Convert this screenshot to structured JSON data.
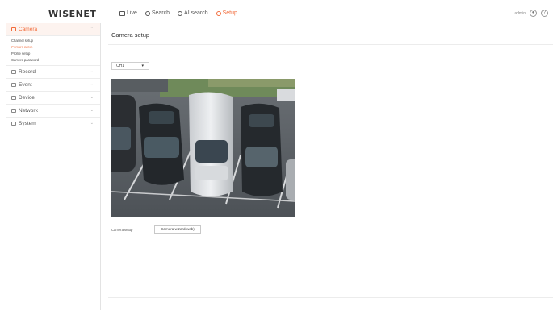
{
  "header": {
    "logo": "WISENET",
    "nav": [
      {
        "label": "Live",
        "icon": "monitor-icon",
        "active": false
      },
      {
        "label": "Search",
        "icon": "search-icon",
        "active": false
      },
      {
        "label": "AI search",
        "icon": "ai-search-icon",
        "active": false
      },
      {
        "label": "Setup",
        "icon": "gear-icon",
        "active": true
      }
    ],
    "user": "admin",
    "user_icon": "user-icon",
    "help_icon": "help-icon",
    "accent": "#f26b3a"
  },
  "sidebar": {
    "groups": [
      {
        "label": "Camera",
        "icon": "camera-icon",
        "active": true,
        "items": [
          {
            "label": "Channel setup",
            "active": false
          },
          {
            "label": "Camera setup",
            "active": true
          },
          {
            "label": "Profile setup",
            "active": false
          },
          {
            "label": "Camera password",
            "active": false
          }
        ]
      },
      {
        "label": "Record",
        "icon": "record-icon",
        "active": false
      },
      {
        "label": "Event",
        "icon": "bell-icon",
        "active": false
      },
      {
        "label": "Device",
        "icon": "device-icon",
        "active": false
      },
      {
        "label": "Network",
        "icon": "network-icon",
        "active": false
      },
      {
        "label": "System",
        "icon": "system-icon",
        "active": false
      }
    ]
  },
  "main": {
    "title": "Camera setup",
    "channel_select": "CH1",
    "camera_setup_label": "Camera setup",
    "wizard_button": "Camera wizard(web)"
  }
}
